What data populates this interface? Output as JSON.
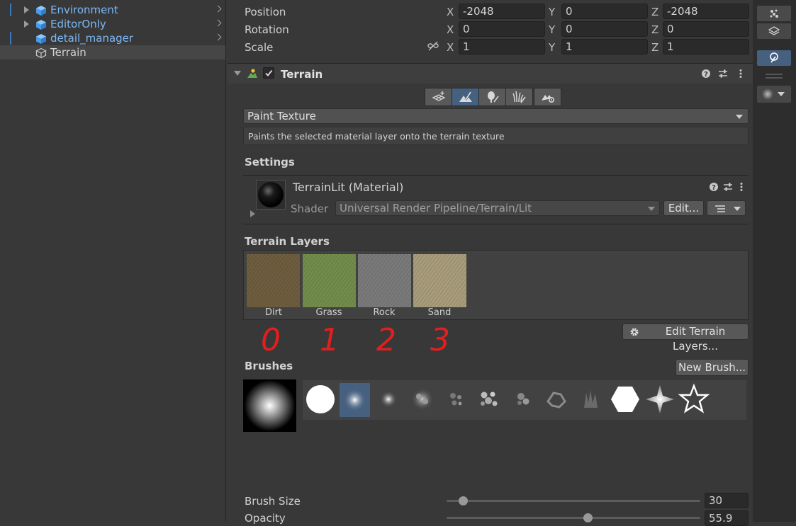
{
  "hierarchy": {
    "items": [
      {
        "label": "Environment",
        "blue": true
      },
      {
        "label": "EditorOnly",
        "blue": true
      },
      {
        "label": "detail_manager",
        "blue": true
      },
      {
        "label": "Terrain",
        "blue": false,
        "selected": true
      }
    ]
  },
  "transform": {
    "position": {
      "label": "Position",
      "x": "-2048",
      "y": "0",
      "z": "-2048"
    },
    "rotation": {
      "label": "Rotation",
      "x": "0",
      "y": "0",
      "z": "0"
    },
    "scale": {
      "label": "Scale",
      "x": "1",
      "y": "1",
      "z": "1"
    },
    "axis_x": "X",
    "axis_y": "Y",
    "axis_z": "Z"
  },
  "terrain_component": {
    "title": "Terrain",
    "enabled": true,
    "tool_names": [
      "create-neighbor-terrains-tool",
      "paint-terrain-tool",
      "paint-trees-tool",
      "paint-details-tool",
      "terrain-settings-tool"
    ],
    "active_tool_index": 1,
    "mode_dropdown": "Paint Texture",
    "mode_description": "Paints the selected material layer onto the terrain texture",
    "settings_title": "Settings",
    "material_name": "TerrainLit (Material)",
    "shader_label": "Shader",
    "shader_value": "Universal Render Pipeline/Terrain/Lit",
    "edit_button": "Edit...",
    "terrain_layers_title": "Terrain Layers",
    "layers": [
      {
        "name": "Dirt",
        "color": "#6b5a3a"
      },
      {
        "name": "Grass",
        "color": "#6f8a48"
      },
      {
        "name": "Rock",
        "color": "#777777"
      },
      {
        "name": "Sand",
        "color": "#a69a78"
      }
    ],
    "layer_annotations": [
      "0",
      "1",
      "2",
      "3"
    ],
    "edit_layers_button": "Edit Terrain Layers...",
    "brushes_title": "Brushes",
    "new_brush_button": "New Brush...",
    "brush_size_label": "Brush Size",
    "brush_size_value": "30",
    "brush_size_fraction": 0.05,
    "opacity_label": "Opacity",
    "opacity_value": "55.9",
    "opacity_fraction": 0.56
  },
  "colors": {
    "accent": "#3a79bb",
    "selected_tool": "#46607f",
    "annotation": "#e41e1e"
  }
}
